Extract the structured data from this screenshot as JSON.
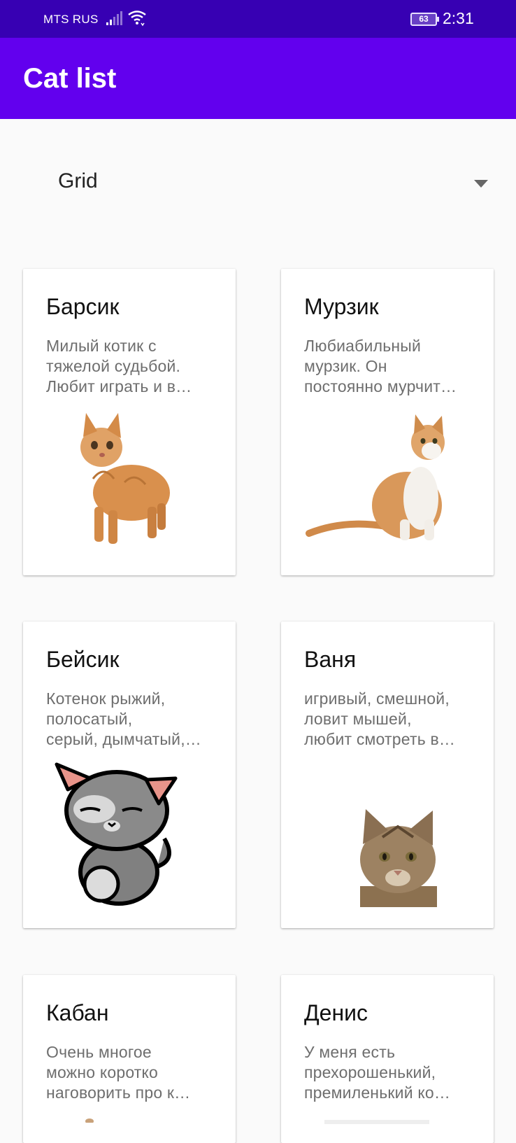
{
  "status_bar": {
    "carrier": "MTS RUS",
    "battery": "63",
    "time": "2:31"
  },
  "app_bar": {
    "title": "Cat list"
  },
  "layout_selector": {
    "selected": "Grid"
  },
  "cats": [
    {
      "name": "Барсик",
      "description": "Милый котик с\nтяжелой судьбой.\nЛюбит играть и в…",
      "image": "ginger-kitten-standing"
    },
    {
      "name": "Мурзик",
      "description": "Любиабильный\nмурзик. Он\nпостоянно мурчит…",
      "image": "ginger-white-cat-sitting"
    },
    {
      "name": "Бейсик",
      "description": "Котенок рыжий,\nполосатый,\nсерый, дымчатый,…",
      "image": "cartoon-grey-cat"
    },
    {
      "name": "Ваня",
      "description": "игривый, смешной,\nловит мышей,\nлюбит смотреть в…",
      "image": "tabby-cat-head"
    },
    {
      "name": "Кабан",
      "description": "Очень многое\nможно коротко\nнаговорить про к…",
      "image": ""
    },
    {
      "name": "Денис",
      "description": "У меня есть\nпрехорошенький,\nпремиленький ко…",
      "image": ""
    }
  ],
  "colors": {
    "status_bar": "#3700b3",
    "app_bar": "#6200ee",
    "background": "#fafafa"
  }
}
